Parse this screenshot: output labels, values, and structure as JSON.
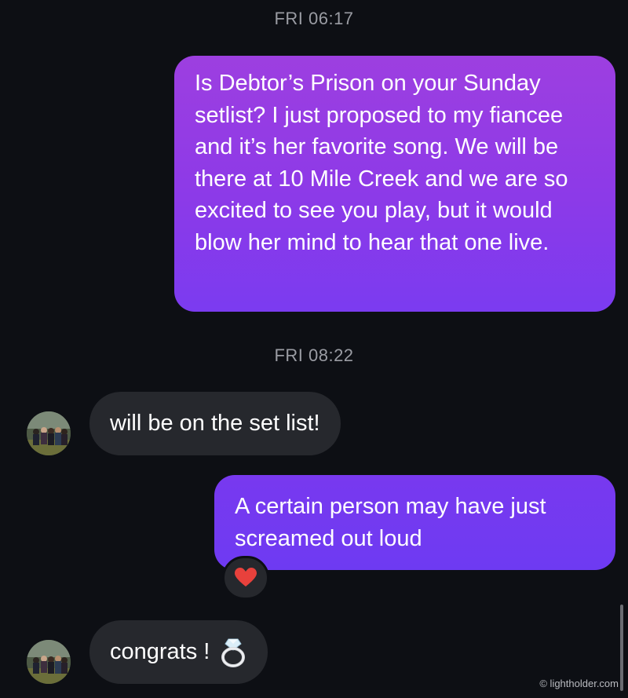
{
  "conversation": {
    "timestamps": [
      "FRI 06:17",
      "FRI 08:22"
    ],
    "messages": [
      {
        "direction": "outgoing",
        "text": "Is Debtor’s Prison on your Sunday setlist? I just proposed to my fiancee and it’s her favorite song. We will be there at 10 Mile Creek and we are so excited to see you play, but it would blow her mind to hear that one live."
      },
      {
        "direction": "incoming",
        "text": "will be on the set list!"
      },
      {
        "direction": "outgoing",
        "text": "A certain person may have just screamed out loud",
        "reaction": "heart-icon"
      },
      {
        "direction": "incoming",
        "text": "congrats !",
        "icon": "ring-icon"
      }
    ]
  },
  "watermark": "© lightholder.com",
  "colors": {
    "background": "#0d0f14",
    "outgoing_top": "#9d3fe0",
    "outgoing_bottom": "#6e3af2",
    "incoming": "#26282d",
    "timestamp": "#9a9ca3",
    "reaction_heart": "#e8413c"
  }
}
